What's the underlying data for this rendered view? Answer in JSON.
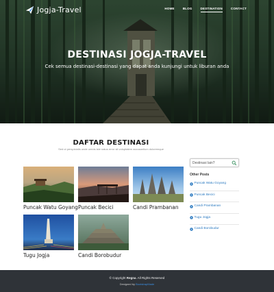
{
  "brand": {
    "name": "Jogja-Travel",
    "icon": "paper-plane-icon"
  },
  "nav": {
    "items": [
      {
        "label": "HOME",
        "active": false
      },
      {
        "label": "BLOG",
        "active": false
      },
      {
        "label": "DESTINATION",
        "active": true
      },
      {
        "label": "CONTACT",
        "active": false
      }
    ]
  },
  "hero": {
    "title": "DESTINASI JOGJA-TRAVEL",
    "subtitle": "Cek semua destinasi-destinasi yang dapat anda kunjungi untuk liburan anda"
  },
  "section": {
    "title": "DAFTAR DESTINASI",
    "subtitle": "Sed ut perspiciatis unde omnis iste natus error sit voluptatem accusantium doloremque"
  },
  "destinations": [
    {
      "name": "Puncak Watu Goyang"
    },
    {
      "name": "Puncak Becici"
    },
    {
      "name": "Candi Prambanan"
    },
    {
      "name": "Tugu Jogja"
    },
    {
      "name": "Candi Borobudur"
    }
  ],
  "sidebar": {
    "search_placeholder": "Destinasi lain?",
    "other_posts_title": "Other Posts",
    "posts": [
      {
        "label": "Puncak Watu Goyang"
      },
      {
        "label": "Puncak Becici"
      },
      {
        "label": "Candi Prambanan"
      },
      {
        "label": "Tugu Jogja"
      },
      {
        "label": "Candi Borobudur"
      }
    ]
  },
  "footer": {
    "copyright_prefix": "© Copyright",
    "copyright_brand": "Regna",
    "copyright_suffix": ". All Rights Reserved",
    "designed_by_prefix": "Designed by",
    "designed_by_link": "BootstrapMade"
  },
  "colors": {
    "accent": "#2a79c0",
    "footer_bg": "#2f3338",
    "link": "#3c8ee0"
  }
}
